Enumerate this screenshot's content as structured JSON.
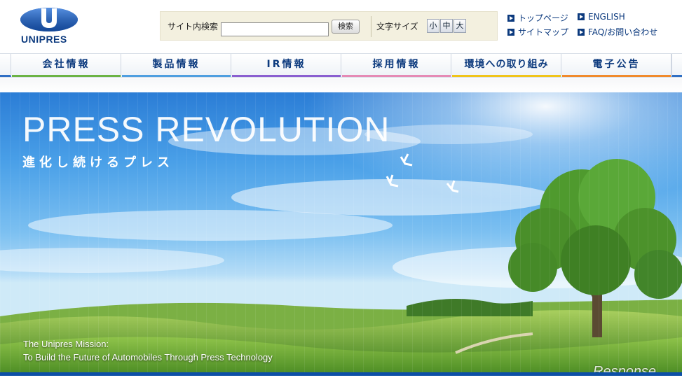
{
  "header": {
    "logo_text": "UNIPRES",
    "search": {
      "label": "サイト内検索",
      "value": "",
      "placeholder": "",
      "button_label": "検索"
    },
    "font_size": {
      "label": "文字サイズ",
      "small": "小",
      "medium": "中",
      "large": "大"
    },
    "utility_links": [
      {
        "label": "トップページ"
      },
      {
        "label": "ENGLISH"
      },
      {
        "label": "サイトマップ"
      },
      {
        "label": "FAQ/お問い合わせ"
      }
    ]
  },
  "nav": {
    "items": [
      {
        "label": "会社情報",
        "color": "#6bb344"
      },
      {
        "label": "製品情報",
        "color": "#4f9fe0"
      },
      {
        "label": "IR情報",
        "color": "#8a5fd0"
      },
      {
        "label": "採用情報",
        "color": "#e58ab5"
      },
      {
        "label": "環境への取り組み",
        "color": "#f0c419"
      },
      {
        "label": "電子公告",
        "color": "#f08a2c"
      }
    ],
    "edge_color": "#2f6fc4"
  },
  "hero": {
    "title": "PRESS REVOLUTION",
    "subtitle": "進化し続けるプレス",
    "mission_line1": "The Unipres Mission:",
    "mission_line2": "To Build the Future of Automobiles Through Press Technology",
    "watermark": "Response."
  },
  "colors": {
    "brand": "#0c3a7e",
    "accent_rule": "#0d4fa6"
  }
}
